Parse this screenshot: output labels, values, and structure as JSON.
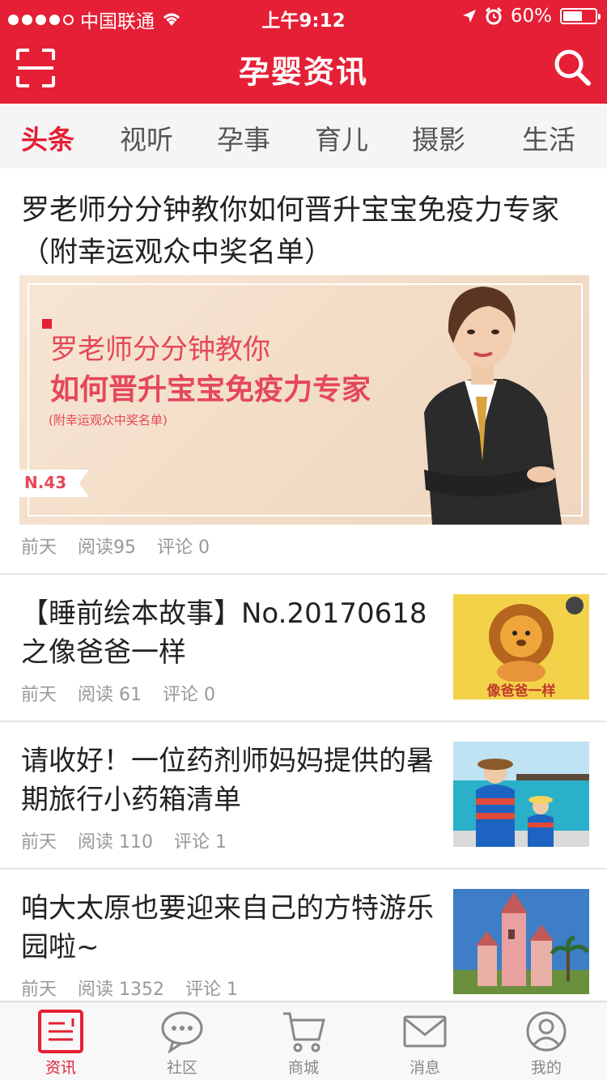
{
  "status_bar": {
    "carrier": "中国联通",
    "time": "上午9:12",
    "battery": "60%",
    "battery_level": 0.6
  },
  "header": {
    "title": "孕婴资讯",
    "scan_icon": "scan-icon",
    "search_icon": "search-icon"
  },
  "tabs": [
    {
      "label": "头条",
      "active": true
    },
    {
      "label": "视听",
      "active": false
    },
    {
      "label": "孕事",
      "active": false
    },
    {
      "label": "育儿",
      "active": false
    },
    {
      "label": "摄影",
      "active": false
    },
    {
      "label": "生活",
      "active": false
    }
  ],
  "featured": {
    "title": "罗老师分分钟教你如何晋升宝宝免疫力专家（附幸运观众中奖名单）",
    "banner": {
      "line1": "罗老师分分钟教你",
      "line2": "如何晋升宝宝免疫力专家",
      "line3": "(附幸运观众中奖名单)",
      "tag": "N.43"
    },
    "date": "前天",
    "reads": "阅读95",
    "comments": "评论 0"
  },
  "articles": [
    {
      "title": "【睡前绘本故事】No.20170618之像爸爸一样",
      "date": "前天",
      "reads": "阅读 61",
      "comments": "评论 0",
      "thumb_text": "像爸爸一样"
    },
    {
      "title": "请收好！一位药剂师妈妈提供的暑期旅行小药箱清单",
      "date": "前天",
      "reads": "阅读 110",
      "comments": "评论 1"
    },
    {
      "title": "咱大太原也要迎来自己的方特游乐园啦~",
      "date": "前天",
      "reads": "阅读 1352",
      "comments": "评论 1"
    }
  ],
  "bottom_nav": [
    {
      "label": "资讯",
      "icon": "news-icon",
      "active": true
    },
    {
      "label": "社区",
      "icon": "chat-icon",
      "active": false
    },
    {
      "label": "商城",
      "icon": "cart-icon",
      "active": false
    },
    {
      "label": "消息",
      "icon": "mail-icon",
      "active": false
    },
    {
      "label": "我的",
      "icon": "profile-icon",
      "active": false
    }
  ],
  "colors": {
    "brand_red": "#e51f35",
    "muted_text": "#999999"
  }
}
